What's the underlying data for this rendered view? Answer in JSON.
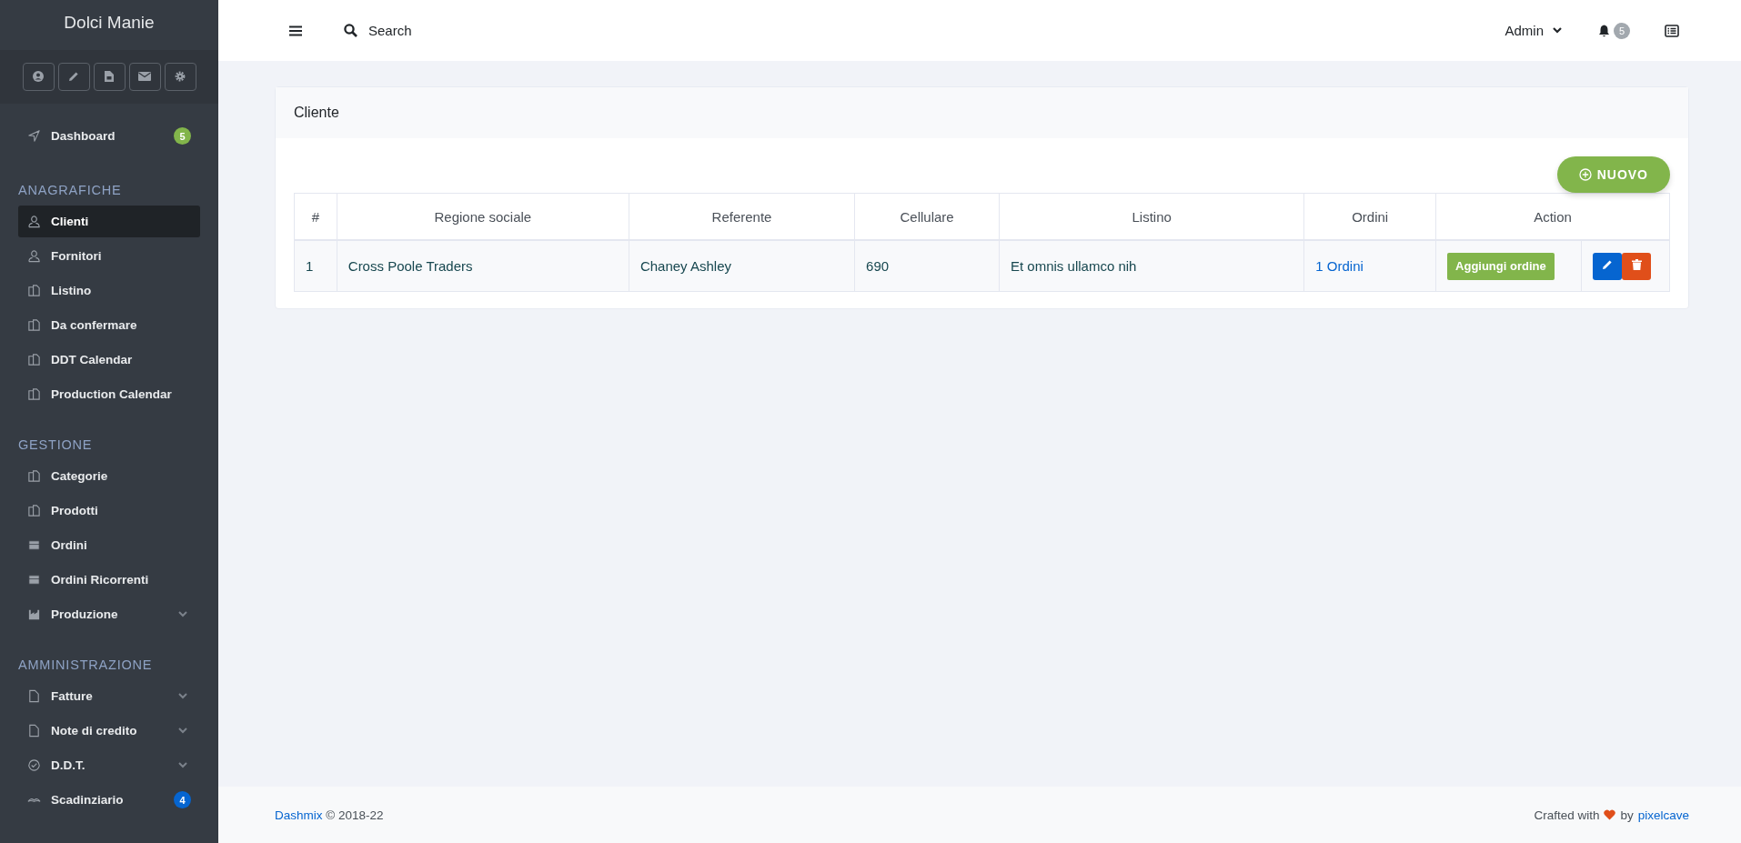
{
  "sidebar": {
    "brand": "Dolci Manie",
    "sections": [
      {
        "items": [
          {
            "label": "Dashboard",
            "selected": false,
            "submenu": false,
            "badge": "5",
            "color": "#82b54b"
          }
        ]
      },
      {
        "heading": "ANAGRAFICHE",
        "items": [
          {
            "label": "Clienti",
            "selected": true,
            "submenu": false
          },
          {
            "label": "Fornitori",
            "selected": false,
            "submenu": false
          },
          {
            "label": "Listino",
            "selected": false,
            "submenu": false
          },
          {
            "label": "Da confermare",
            "selected": false,
            "submenu": false
          },
          {
            "label": "DDT Calendar",
            "selected": false,
            "submenu": false
          },
          {
            "label": "Production Calendar",
            "selected": false,
            "submenu": false
          }
        ]
      },
      {
        "heading": "GESTIONE",
        "items": [
          {
            "label": "Categorie",
            "selected": false,
            "submenu": false
          },
          {
            "label": "Prodotti",
            "selected": false,
            "submenu": false
          },
          {
            "label": "Ordini",
            "selected": false,
            "submenu": false
          },
          {
            "label": "Ordini Ricorrenti",
            "selected": false,
            "submenu": false
          },
          {
            "label": "Produzione",
            "selected": false,
            "submenu": true
          }
        ]
      },
      {
        "heading": "AMMINISTRAZIONE",
        "items": [
          {
            "label": "Fatture",
            "selected": false,
            "submenu": true
          },
          {
            "label": "Note di credito",
            "selected": false,
            "submenu": true
          },
          {
            "label": "D.D.T.",
            "selected": false,
            "submenu": true
          },
          {
            "label": "Scadinziario",
            "selected": false,
            "submenu": false,
            "badge": "4",
            "color": "#0665d0"
          }
        ]
      }
    ]
  },
  "header": {
    "search": "Search",
    "user": "Admin",
    "notifications": "5"
  },
  "card": {
    "title": "Cliente",
    "new_button": "NUOVO",
    "table": {
      "columns": [
        "#",
        "Regione sociale",
        "Referente",
        "Cellulare",
        "Listino",
        "Ordini",
        "Action"
      ],
      "rows": [
        {
          "cells": [
            "1",
            "Cross Poole Traders",
            "Chaney Ashley",
            "690",
            "Et omnis ullamco nih"
          ],
          "orders_link": "1 Ordini",
          "action_button": "Aggiungi ordine"
        }
      ]
    }
  },
  "footer": {
    "brand_link": "Dashmix",
    "copyright": "© 2018-22",
    "crafted": "Crafted with",
    "by": "by",
    "author_link": "pixelcave"
  }
}
